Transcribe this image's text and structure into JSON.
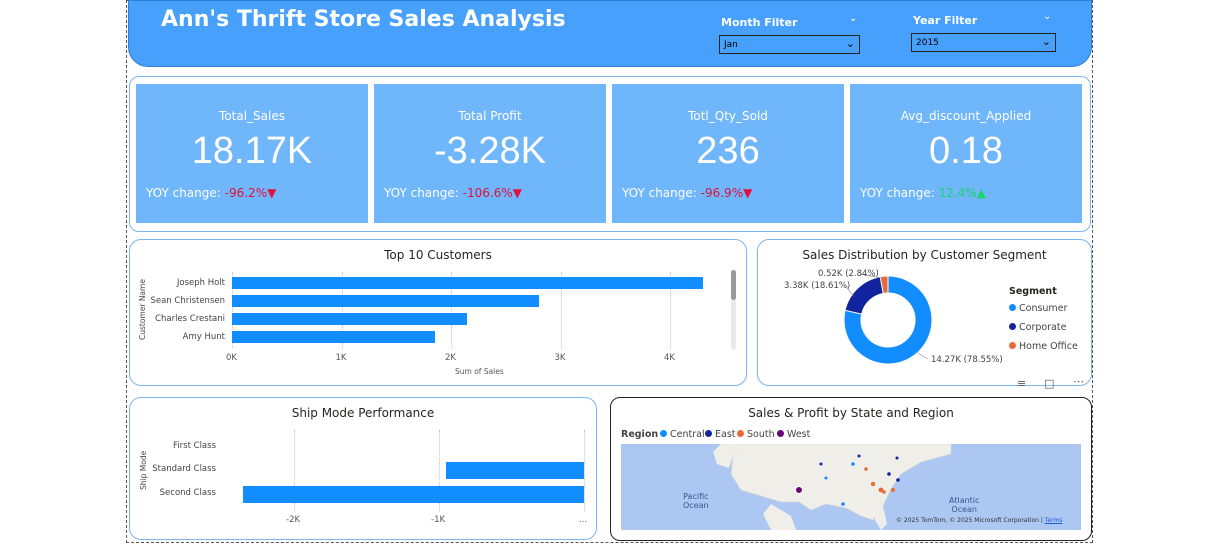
{
  "header": {
    "title": "Ann's Thrift Store Sales Analysis",
    "month_filter": {
      "label": "Month Filter",
      "value": "Jan"
    },
    "year_filter": {
      "label": "Year Filter",
      "value": "2015"
    }
  },
  "kpis": [
    {
      "title": "Total_Sales",
      "value": "18.17K",
      "yoy_label": "YOY change:",
      "yoy": "-96.2%",
      "dir": "down"
    },
    {
      "title": "Total Profit",
      "value": "-3.28K",
      "yoy_label": "YOY change:",
      "yoy": "-106.6%",
      "dir": "down"
    },
    {
      "title": "Totl_Qty_Sold",
      "value": "236",
      "yoy_label": "YOY change:",
      "yoy": "-96.9%",
      "dir": "down"
    },
    {
      "title": "Avg_discount_Applied",
      "value": "0.18",
      "yoy_label": "YOY change:",
      "yoy": "12.4%",
      "dir": "up"
    }
  ],
  "top_customers": {
    "title": "Top 10 Customers",
    "ylabel": "Customer Name",
    "xlabel": "Sum of Sales",
    "categories": [
      "Joseph Holt",
      "Sean Christensen",
      "Charles Crestani",
      "Amy Hunt"
    ],
    "values": [
      4300,
      2800,
      2150,
      1850
    ],
    "xticks": [
      "0K",
      "1K",
      "2K",
      "3K",
      "4K"
    ],
    "xlim": [
      0,
      4000
    ]
  },
  "segment": {
    "title": "Sales Distribution by Customer Segment",
    "legend_title": "Segment",
    "slices": [
      {
        "name": "Consumer",
        "value": 14270,
        "label": "14.27K (78.55%)",
        "color": "#118dff"
      },
      {
        "name": "Corporate",
        "value": 3380,
        "label": "3.38K (18.61%)",
        "color": "#12239e"
      },
      {
        "name": "Home Office",
        "value": 520,
        "label": "0.52K (2.84%)",
        "color": "#e66c37"
      }
    ]
  },
  "ship_mode": {
    "title": "Ship Mode Performance",
    "ylabel": "Ship Mode",
    "categories": [
      "First Class",
      "Standard Class",
      "Second Class"
    ],
    "values": [
      0,
      -950,
      -2350
    ],
    "xticks": [
      "-2K",
      "-1K",
      "..."
    ]
  },
  "map": {
    "title": "Sales & Profit by State and Region",
    "legend_title": "Region",
    "regions": [
      {
        "name": "Central",
        "color": "#118dff"
      },
      {
        "name": "East",
        "color": "#12239e"
      },
      {
        "name": "South",
        "color": "#e66c37"
      },
      {
        "name": "West",
        "color": "#6b007b"
      }
    ],
    "ocean_pacific": "Pacific\nOcean",
    "ocean_atlantic": "Atlantic\nOcean",
    "attribution": "© 2025 TomTom, © 2025 Microsoft Corporation",
    "terms": "Terms"
  }
}
